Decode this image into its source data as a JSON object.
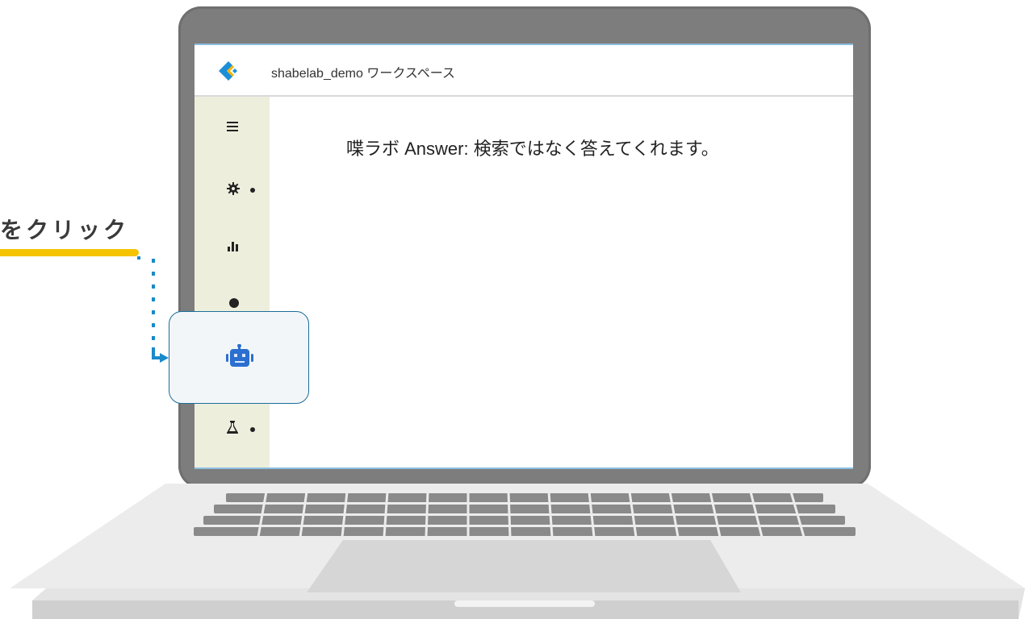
{
  "workspace": {
    "title": "shabelab_demo ワークスペース"
  },
  "main": {
    "headline": "喋ラボ Answer: 検索ではなく答えてくれます。"
  },
  "sidebar": {
    "items": [
      {
        "name": "menu",
        "icon": "hamburger-menu-icon"
      },
      {
        "name": "settings",
        "icon": "gear-icon"
      },
      {
        "name": "analytics",
        "icon": "bar-chart-icon"
      },
      {
        "name": "ideas",
        "icon": "lightbulb-icon"
      },
      {
        "name": "bot",
        "icon": "robot-icon"
      },
      {
        "name": "lab",
        "icon": "flask-icon"
      }
    ]
  },
  "callout": {
    "text": "をクリック"
  },
  "colors": {
    "accent_blue": "#2b6fd1",
    "logo_blue": "#1d8fd8",
    "logo_yellow": "#f4b400",
    "underline_yellow": "#f5c400",
    "connector_blue": "#1a8ac9",
    "sidebar_bg": "#eeeedd"
  }
}
